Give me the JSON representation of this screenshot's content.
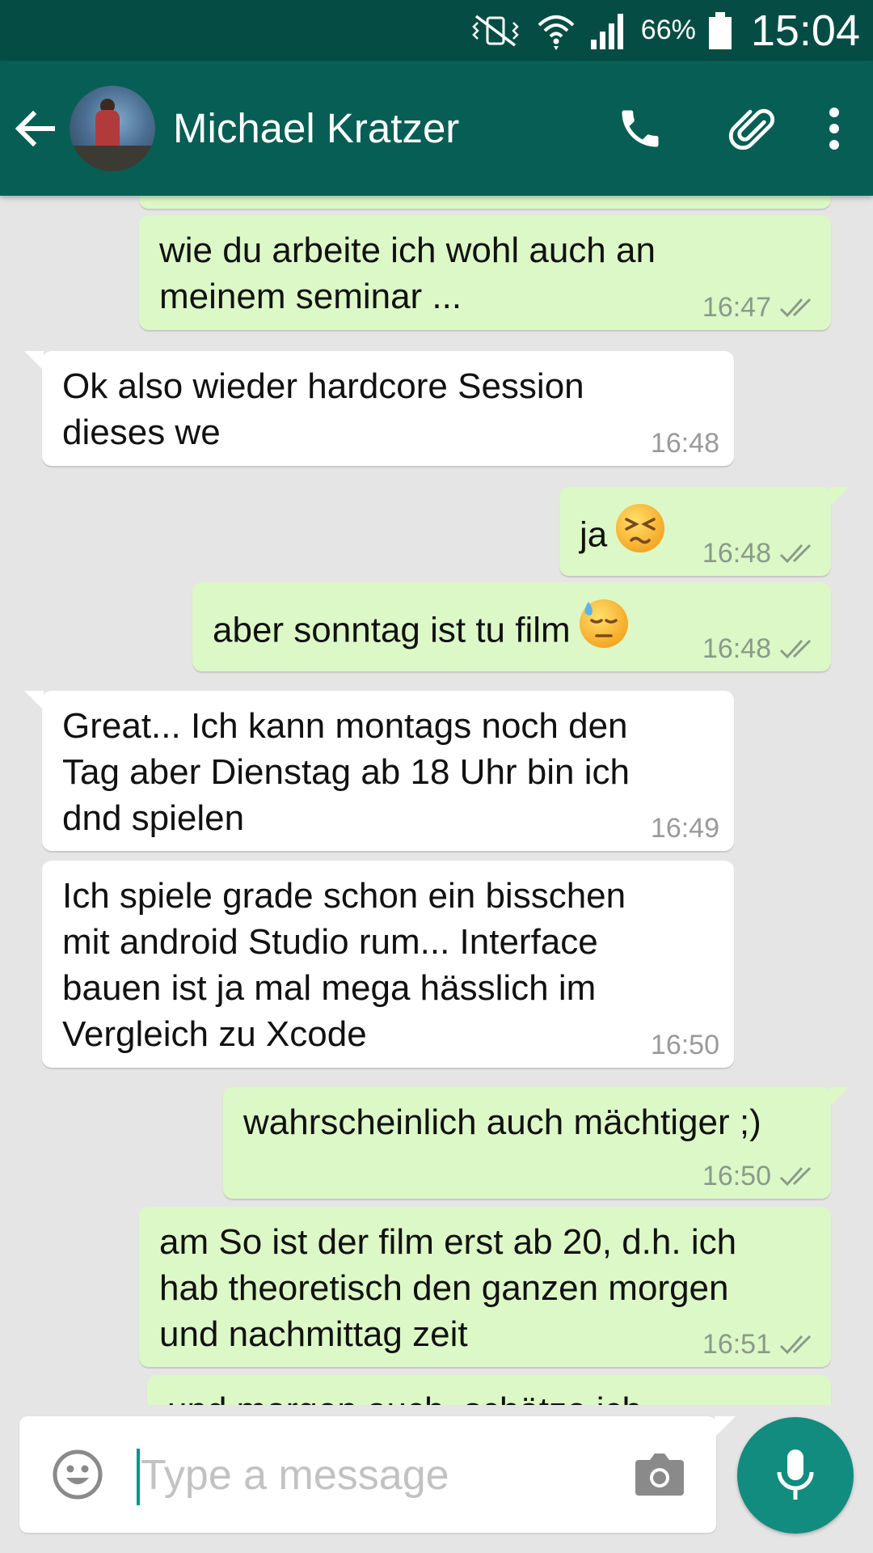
{
  "status_bar": {
    "icons": [
      "vibrate-mute-icon",
      "wifi-icon",
      "cell-signal-icon",
      "battery-icon"
    ],
    "battery": "66%",
    "time": "15:04"
  },
  "header": {
    "contact_name": "Michael Kratzer",
    "icons": [
      "back-arrow-icon",
      "avatar",
      "phone-icon",
      "paperclip-icon",
      "more-vert-icon"
    ]
  },
  "messages": [
    {
      "direction": "out",
      "text": [
        "wie du arbeite ich wohl auch an",
        "meinem seminar ..."
      ],
      "time": "16:47",
      "status": "read"
    },
    {
      "direction": "in",
      "text": [
        "Ok also wieder hardcore Session",
        "dieses we"
      ],
      "time": "16:48"
    },
    {
      "direction": "out",
      "text": [
        "ja"
      ],
      "emoji": "persevering-face-emoji",
      "time": "16:48",
      "status": "read"
    },
    {
      "direction": "out",
      "text": [
        "aber sonntag ist tu film"
      ],
      "emoji": "downcast-sweat-face-emoji",
      "time": "16:48",
      "status": "read"
    },
    {
      "direction": "in",
      "text": [
        "Great... Ich kann montags noch den",
        "Tag aber Dienstag ab 18 Uhr bin ich",
        "dnd spielen"
      ],
      "time": "16:49"
    },
    {
      "direction": "in",
      "text": [
        "Ich spiele grade schon ein bisschen",
        "mit android Studio rum... Interface",
        "bauen ist ja mal mega hässlich im",
        "Vergleich zu Xcode"
      ],
      "time": "16:50"
    },
    {
      "direction": "out",
      "text": [
        "wahrscheinlich auch mächtiger ;)"
      ],
      "time": "16:50",
      "status": "read"
    },
    {
      "direction": "out",
      "text": [
        "am So ist der film erst ab 20, d.h. ich",
        "hab theoretisch den ganzen morgen",
        "und nachmittag zeit"
      ],
      "time": "16:51",
      "status": "read"
    },
    {
      "direction": "out",
      "text": [
        "und morgen auch, schätze ich"
      ],
      "partial": true
    }
  ],
  "composer": {
    "placeholder": "Type a message",
    "value": "",
    "icons": [
      "emoji-icon",
      "camera-icon",
      "mic-icon"
    ]
  },
  "colors": {
    "status_bar": "#054d44",
    "header": "#075e54",
    "chat_bg": "#e5e5e5",
    "outgoing_bubble": "#dcf8c6",
    "incoming_bubble": "#ffffff",
    "fab": "#128c7e"
  }
}
